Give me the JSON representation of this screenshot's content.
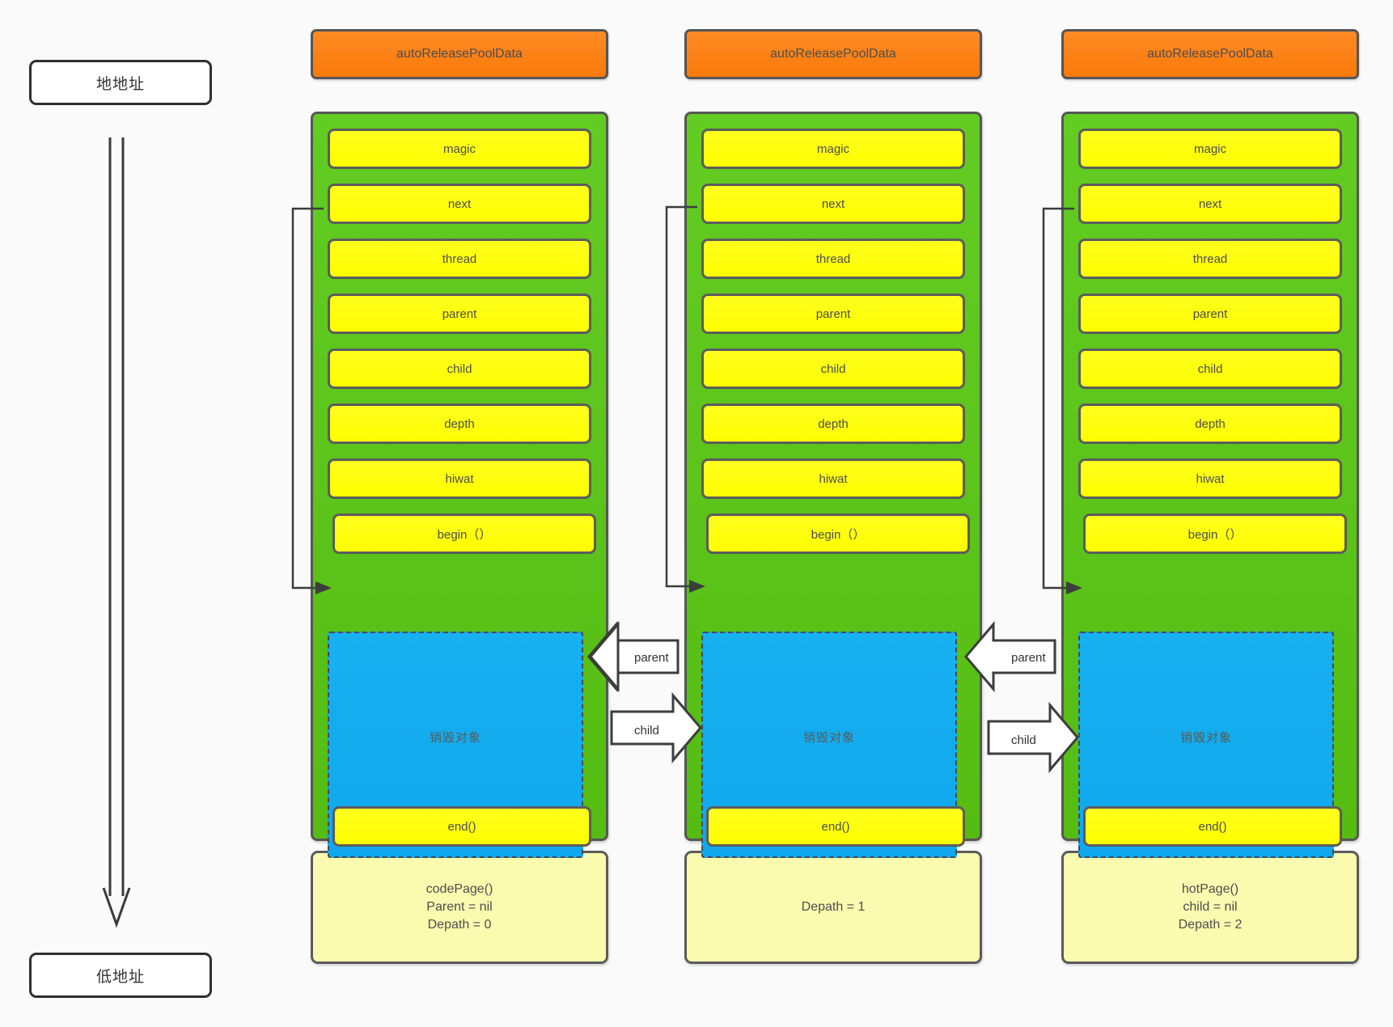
{
  "diagram": {
    "title": "autoreleasepool data page chain",
    "background": "#fafafa",
    "colors": {
      "header_orange": "#f97a09",
      "struct_green": "#5cc81e",
      "field_yellow": "#fdfd00",
      "destroy_blue": "#0fa8ee",
      "note_yellow": "#fbfbb0",
      "stroke_gray": "#575757"
    }
  },
  "address_rail": {
    "high_label": "地地址",
    "low_label": "低地址",
    "arrow_direction": "down",
    "arrow_style": "hollow"
  },
  "columns": [
    {
      "id": "page-0",
      "header": "autoReleasePoolData",
      "fields": [
        "magic",
        "next",
        "thread",
        "parent",
        "child",
        "depth",
        "hiwat"
      ],
      "begin_label": "begin（）",
      "destroy_label": "销毁对象",
      "end_label": "end()",
      "note": "codePage()\nParent = nil\nDepath = 0"
    },
    {
      "id": "page-1",
      "header": "autoReleasePoolData",
      "fields": [
        "magic",
        "next",
        "thread",
        "parent",
        "child",
        "depth",
        "hiwat"
      ],
      "begin_label": "begin（）",
      "destroy_label": "销毁对象",
      "end_label": "end()",
      "note": "Depath = 1"
    },
    {
      "id": "page-2",
      "header": "autoReleasePoolData",
      "fields": [
        "magic",
        "next",
        "thread",
        "parent",
        "child",
        "depth",
        "hiwat"
      ],
      "begin_label": "begin（）",
      "destroy_label": "销毁对象",
      "end_label": "end()",
      "note": "hotPage()\nchild = nil\nDepath = 2"
    }
  ],
  "edges": {
    "next_link_label": "",
    "parent_label_1": "parent",
    "child_label_1": "child",
    "parent_label_2": "parent",
    "child_label_2": "child"
  }
}
